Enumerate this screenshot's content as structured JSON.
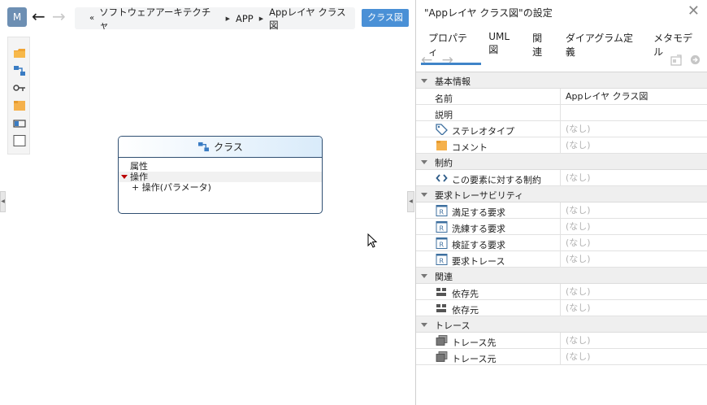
{
  "left": {
    "model_button": "M",
    "back_icon": "←",
    "forward_icon": "→",
    "breadcrumb": {
      "lead": "«",
      "parts": [
        "ソフトウェアアーキテクチャ",
        "APP",
        "Appレイヤ クラス図"
      ]
    },
    "diagram_type_button": "クラス図",
    "palette_tools": [
      "folder-icon",
      "class-icon",
      "association-icon",
      "note-icon",
      "interface-icon",
      "rectangle-icon"
    ],
    "class_box": {
      "title": "クラス",
      "attributes_label": "属性",
      "operations_label": "操作",
      "operation_item": "+ 操作(パラメータ)"
    }
  },
  "panel": {
    "title": "\"Appレイヤ クラス図\"の設定",
    "close_icon": "✕",
    "tabs": [
      "プロパティ",
      "UML図",
      "関連",
      "ダイアグラム定義",
      "メタモデル"
    ],
    "active_tab": 0,
    "nav_back": "←",
    "nav_fwd": "→",
    "rows": [
      {
        "type": "section",
        "label": "基本情報"
      },
      {
        "type": "prop",
        "label": "名前",
        "value": "Appレイヤ クラス図",
        "icon": ""
      },
      {
        "type": "prop",
        "label": "説明",
        "value": "",
        "icon": ""
      },
      {
        "type": "prop",
        "label": "ステレオタイプ",
        "value": "(なし)",
        "icon": "tag-icon"
      },
      {
        "type": "prop",
        "label": "コメント",
        "value": "(なし)",
        "icon": "comment-icon"
      },
      {
        "type": "section",
        "label": "制約"
      },
      {
        "type": "prop",
        "label": "この要素に対する制約",
        "value": "(なし)",
        "icon": "code-icon"
      },
      {
        "type": "section",
        "label": "要求トレーサビリティ"
      },
      {
        "type": "prop",
        "label": "満足する要求",
        "value": "(なし)",
        "icon": "requirement-icon"
      },
      {
        "type": "prop",
        "label": "洗練する要求",
        "value": "(なし)",
        "icon": "requirement-icon"
      },
      {
        "type": "prop",
        "label": "検証する要求",
        "value": "(なし)",
        "icon": "requirement-icon"
      },
      {
        "type": "prop",
        "label": "要求トレース",
        "value": "(なし)",
        "icon": "requirement-icon"
      },
      {
        "type": "section",
        "label": "関連"
      },
      {
        "type": "prop",
        "label": "依存先",
        "value": "(なし)",
        "icon": "dependency-icon"
      },
      {
        "type": "prop",
        "label": "依存元",
        "value": "(なし)",
        "icon": "dependency-icon"
      },
      {
        "type": "section",
        "label": "トレース"
      },
      {
        "type": "prop",
        "label": "トレース先",
        "value": "(なし)",
        "icon": "trace-icon"
      },
      {
        "type": "prop",
        "label": "トレース元",
        "value": "(なし)",
        "icon": "trace-icon"
      }
    ]
  },
  "colors": {
    "accent": "#3f84c8",
    "button": "#4a90d6",
    "class_border": "#2f4f72",
    "muted": "#b3b3b3"
  }
}
